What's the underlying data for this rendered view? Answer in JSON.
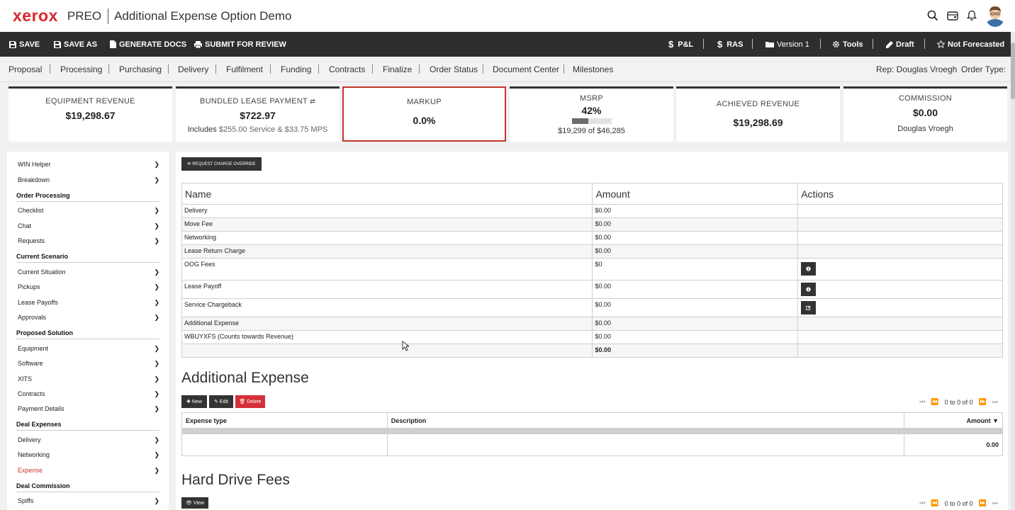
{
  "header": {
    "logo": "xerox",
    "product": "PREO",
    "title": "Additional Expense Option Demo",
    "icons": [
      "search-icon",
      "wallet-icon",
      "bell-icon",
      "user-avatar"
    ]
  },
  "actions": {
    "save": "SAVE",
    "save_as": "SAVE AS",
    "generate_docs": "GENERATE DOCS",
    "submit_review": "SUBMIT FOR REVIEW",
    "pl": "P&L",
    "ras": "RAS",
    "version": "Version 1",
    "tools": "Tools",
    "draft": "Draft",
    "not_forecasted": "Not Forecasted",
    "dollar": "$"
  },
  "tabs": {
    "proposal": "Proposal",
    "processing": "Processing",
    "purchasing": "Purchasing",
    "delivery": "Delivery",
    "fulfilment": "Fulfilment",
    "funding": "Funding",
    "contracts": "Contracts",
    "finalize": "Finalize",
    "order_status": "Order Status",
    "document_center": "Document Center",
    "milestones": "Milestones",
    "rep": "Rep: Douglas Vroegh",
    "order_type": "Order Type:"
  },
  "kpis": {
    "equipment_revenue": {
      "label": "EQUIPMENT REVENUE",
      "value": "$19,298.67"
    },
    "bundled_lease": {
      "label": "BUNDLED LEASE PAYMENT",
      "value": "$722.97",
      "includes": "Includes",
      "detail": "$255.00 Service & $33.75 MPS"
    },
    "markup": {
      "label": "MARKUP",
      "value": "0.0%"
    },
    "msrp": {
      "label": "MSRP",
      "value": "42%",
      "progress": 0.42,
      "sub": "$19,299 of $46,285"
    },
    "achieved_revenue": {
      "label": "ACHIEVED REVENUE",
      "value": "$19,298.69"
    },
    "commission": {
      "label": "COMMISSION",
      "value": "$0.00",
      "sub": "Douglas Vroegh"
    }
  },
  "sidebar": {
    "win_helper": "WIN Helper",
    "breakdown": "Breakdown",
    "order_processing": "Order Processing",
    "checklist": "Checklist",
    "chat": "Chat",
    "requests": "Requests",
    "current_scenario": "Current Scenario",
    "current_situation": "Current Situation",
    "pickups": "Pickups",
    "lease_payoffs": "Lease Payoffs",
    "approvals": "Approvals",
    "proposed_solution": "Proposed Solution",
    "equipment": "Equipment",
    "software": "Software",
    "xits": "XITS",
    "contracts": "Contracts",
    "payment_details": "Payment Details",
    "deal_expenses": "Deal Expenses",
    "delivery": "Delivery",
    "networking": "Networking",
    "expense": "Expense",
    "deal_commission": "Deal Commission",
    "spiffs": "Spiffs"
  },
  "main": {
    "request_override": "REQUEST CHARGE OVERRIDE",
    "charges_header": {
      "name": "Name",
      "amount": "Amount",
      "actions": "Actions"
    },
    "charges": [
      {
        "name": "Delivery",
        "amount": "$0.00"
      },
      {
        "name": "Move Fee",
        "amount": "$0.00"
      },
      {
        "name": "Networking",
        "amount": "$0.00"
      },
      {
        "name": "Lease Return Charge",
        "amount": "$0.00"
      },
      {
        "name": "OOG Fees",
        "amount": "$0"
      },
      {
        "name": "Lease Payoff",
        "amount": "$0.00"
      },
      {
        "name": "Service Chargeback",
        "amount": "$0.00"
      },
      {
        "name": "Additional Expense",
        "amount": "$0.00"
      },
      {
        "name": "WBUYXFS (Counts towards Revenue)",
        "amount": "$0.00"
      }
    ],
    "charges_total": "$0.00",
    "additional_expense_title": "Additional Expense",
    "new": "New",
    "edit": "Edit",
    "delete": "Delete",
    "pager_text": "0 to 0 of 0",
    "expense_header": {
      "type": "Expense type",
      "description": "Description",
      "amount": "Amount ▼"
    },
    "expense_total": "0.00",
    "hard_drive_title": "Hard Drive Fees",
    "view": "View",
    "pager_text_2": "0 to 0 of 0"
  }
}
